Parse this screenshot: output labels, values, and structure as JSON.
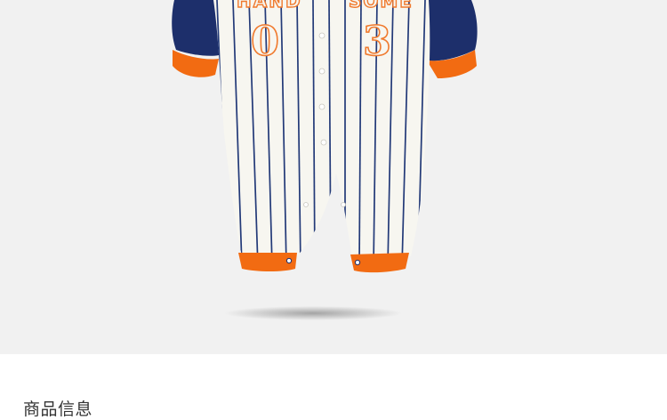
{
  "product_image": {
    "print_word_left": "HAND",
    "print_word_right": "SOME",
    "number_left": "0",
    "number_right": "3",
    "colors": {
      "background": "#f1f1f1",
      "body": "#f7f6f0",
      "stripe": "#233a78",
      "sleeve": "#1d2f6b",
      "cuff": "#f26b12",
      "print": "#f07a2e"
    }
  },
  "info": {
    "title": "商品信息"
  }
}
